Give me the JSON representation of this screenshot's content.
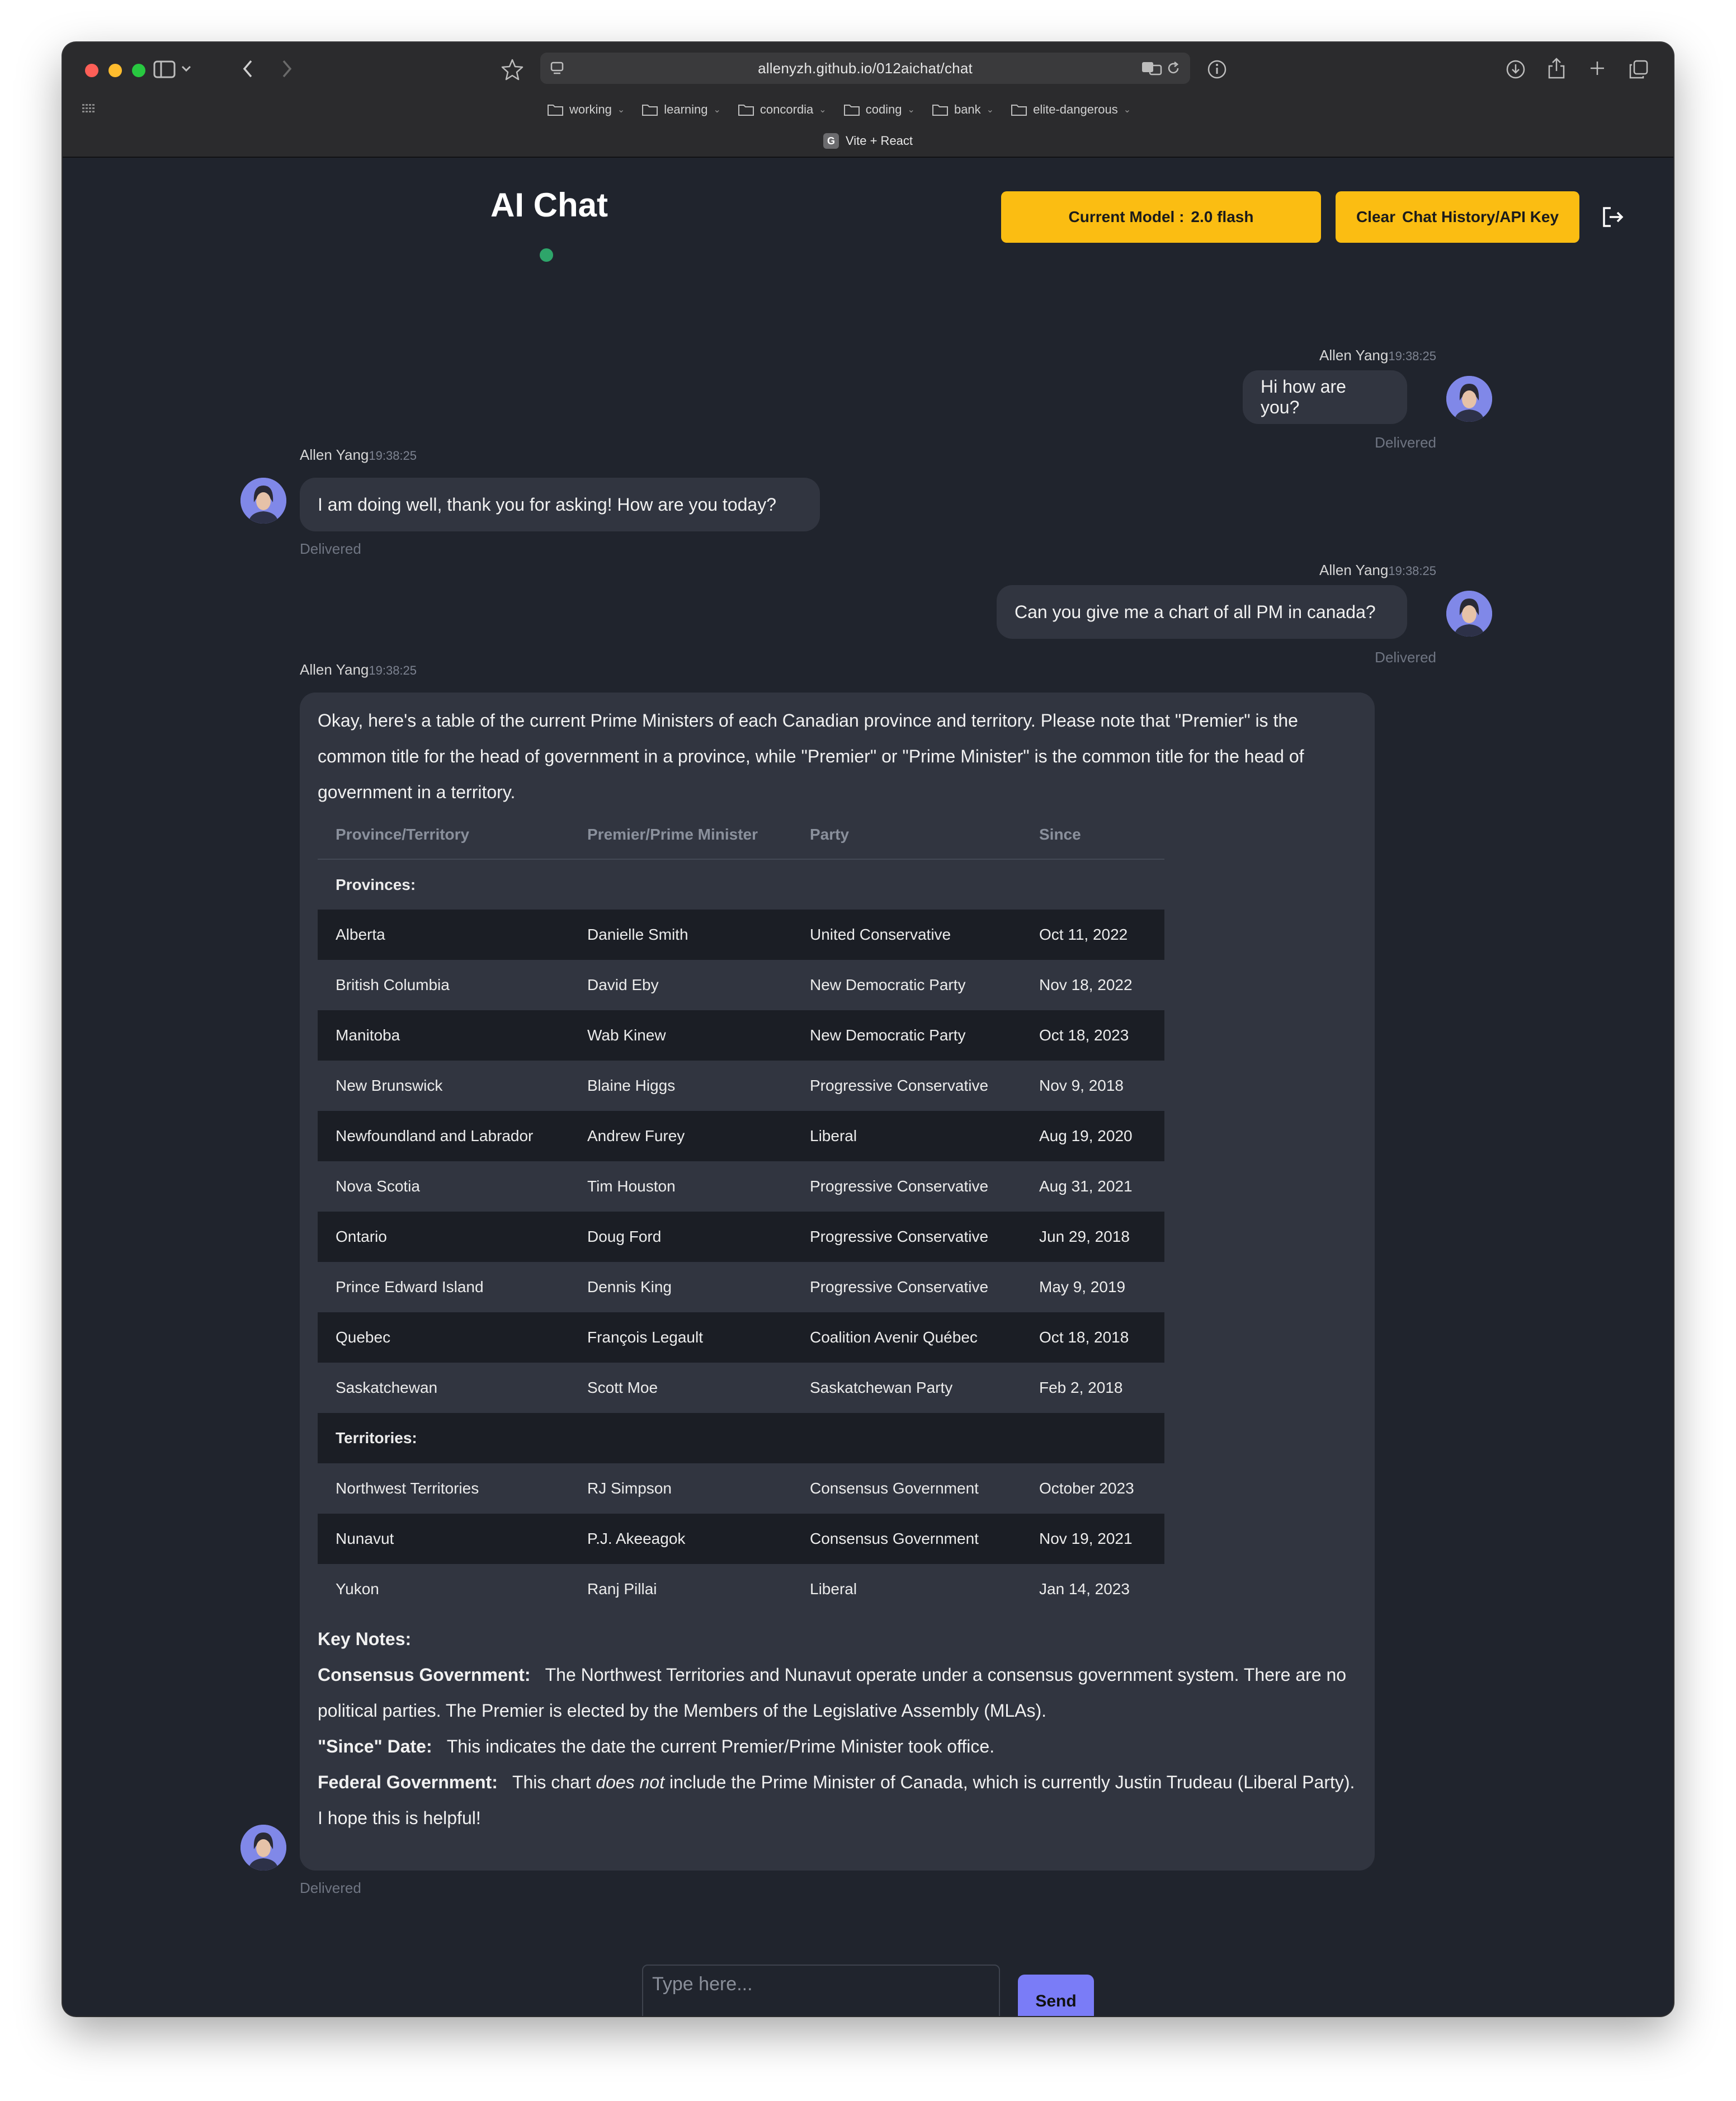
{
  "browser": {
    "url": "allenyzh.github.io/012aichat/chat",
    "tab_title": "Vite + React",
    "favicon_letter": "G",
    "bookmarks": [
      "working",
      "learning",
      "concordia",
      "coding",
      "bank",
      "elite-dangerous"
    ]
  },
  "header": {
    "title": "AI Chat",
    "model_label": "Current Model :",
    "model_value": "2.0 flash",
    "clear_label_1": "Clear",
    "clear_label_2": "Chat History/API Key",
    "status_color": "#2ea56a"
  },
  "messages": [
    {
      "sender": "Allen Yang",
      "time": "19:38:25",
      "text": "Hi how are you?",
      "status": "Delivered",
      "side": "right"
    },
    {
      "sender": "Allen Yang",
      "time": "19:38:25",
      "text": "I am doing well, thank you for asking! How are you today?",
      "status": "Delivered",
      "side": "left"
    },
    {
      "sender": "Allen Yang",
      "time": "19:38:25",
      "text": "Can you give me a chart of all PM in canada?",
      "status": "Delivered",
      "side": "right"
    },
    {
      "sender": "Allen Yang",
      "time": "19:38:25",
      "status": "Delivered",
      "side": "left",
      "intro": "Okay, here's a table of the current Prime Ministers of each Canadian province and territory. Please note that \"Premier\" is the common title for the head of government in a province, while \"Premier\" or \"Prime Minister\" is the common title for the head of government in a territory."
    }
  ],
  "table": {
    "headers": [
      "Province/Territory",
      "Premier/Prime Minister",
      "Party",
      "Since"
    ],
    "provinces_label": "Provinces:",
    "territories_label": "Territories:",
    "provinces": [
      [
        "Alberta",
        "Danielle Smith",
        "United Conservative",
        "Oct 11, 2022"
      ],
      [
        "British Columbia",
        "David Eby",
        "New Democratic Party",
        "Nov 18, 2022"
      ],
      [
        "Manitoba",
        "Wab Kinew",
        "New Democratic Party",
        "Oct 18, 2023"
      ],
      [
        "New Brunswick",
        "Blaine Higgs",
        "Progressive Conservative",
        "Nov 9, 2018"
      ],
      [
        "Newfoundland and Labrador",
        "Andrew Furey",
        "Liberal",
        "Aug 19, 2020"
      ],
      [
        "Nova Scotia",
        "Tim Houston",
        "Progressive Conservative",
        "Aug 31, 2021"
      ],
      [
        "Ontario",
        "Doug Ford",
        "Progressive Conservative",
        "Jun 29, 2018"
      ],
      [
        "Prince Edward Island",
        "Dennis King",
        "Progressive Conservative",
        "May 9, 2019"
      ],
      [
        "Quebec",
        "François Legault",
        "Coalition Avenir Québec",
        "Oct 18, 2018"
      ],
      [
        "Saskatchewan",
        "Scott Moe",
        "Saskatchewan Party",
        "Feb 2, 2018"
      ]
    ],
    "territories": [
      [
        "Northwest Territories",
        "RJ Simpson",
        "Consensus Government",
        "October 2023"
      ],
      [
        "Nunavut",
        "P.J. Akeeagok",
        "Consensus Government",
        "Nov 19, 2021"
      ],
      [
        "Yukon",
        "Ranj Pillai",
        "Liberal",
        "Jan 14, 2023"
      ]
    ]
  },
  "notes": {
    "heading": "Key Notes:",
    "consensus_label": "Consensus Government:",
    "consensus_text": "The Northwest Territories and Nunavut operate under a consensus government system. There are no political parties. The Premier is elected by the Members of the Legislative Assembly (MLAs).",
    "since_label": "\"Since\" Date:",
    "since_text": "This indicates the date the current Premier/Prime Minister took office.",
    "federal_label": "Federal Government:",
    "federal_text_1": "This chart",
    "federal_emph": "does not",
    "federal_text_2": "include the Prime Minister of Canada, which is currently Justin Trudeau (Liberal Party).",
    "closing": "I hope this is helpful!"
  },
  "composer": {
    "placeholder": "Type here...",
    "send_label": "Send"
  },
  "colors": {
    "accent_yellow": "#fbbd12",
    "send_button": "#7a7cf7",
    "background": "#20242d",
    "bubble": "#313540"
  }
}
